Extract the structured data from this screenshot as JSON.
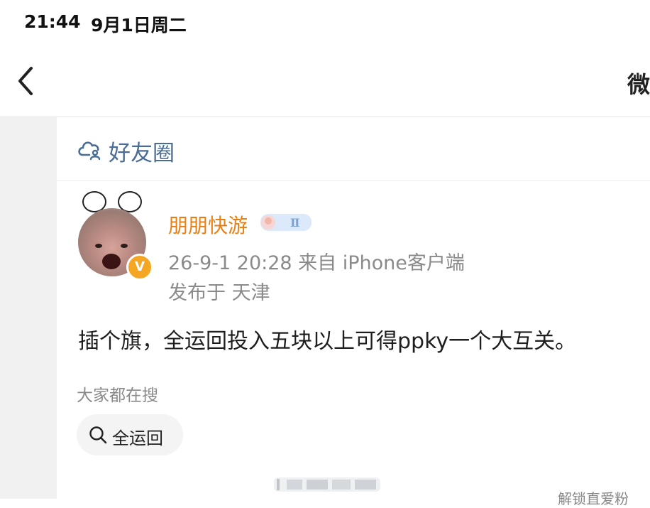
{
  "status_bar": {
    "time": "21:44",
    "date": "9月1日周二"
  },
  "nav": {
    "title": "微"
  },
  "circle": {
    "label": "好友圈",
    "icon": "cloud-people-icon"
  },
  "post": {
    "username": "朋朋快游",
    "meta": "26-9-1 20:28  来自 iPhone客户端",
    "location": "发布于 天津",
    "content": "插个旗，全运回投入五块以上可得ppky一个大互关。",
    "verified_badge": "V"
  },
  "trending": {
    "label": "大家都在搜",
    "chip": "全运回"
  },
  "footer": {
    "cutoff_text": "解锁直爱粉"
  },
  "colors": {
    "username": "#eb7e10",
    "link": "#4a6d96",
    "meta": "#8a8a8a",
    "badge": "#f5a623"
  }
}
